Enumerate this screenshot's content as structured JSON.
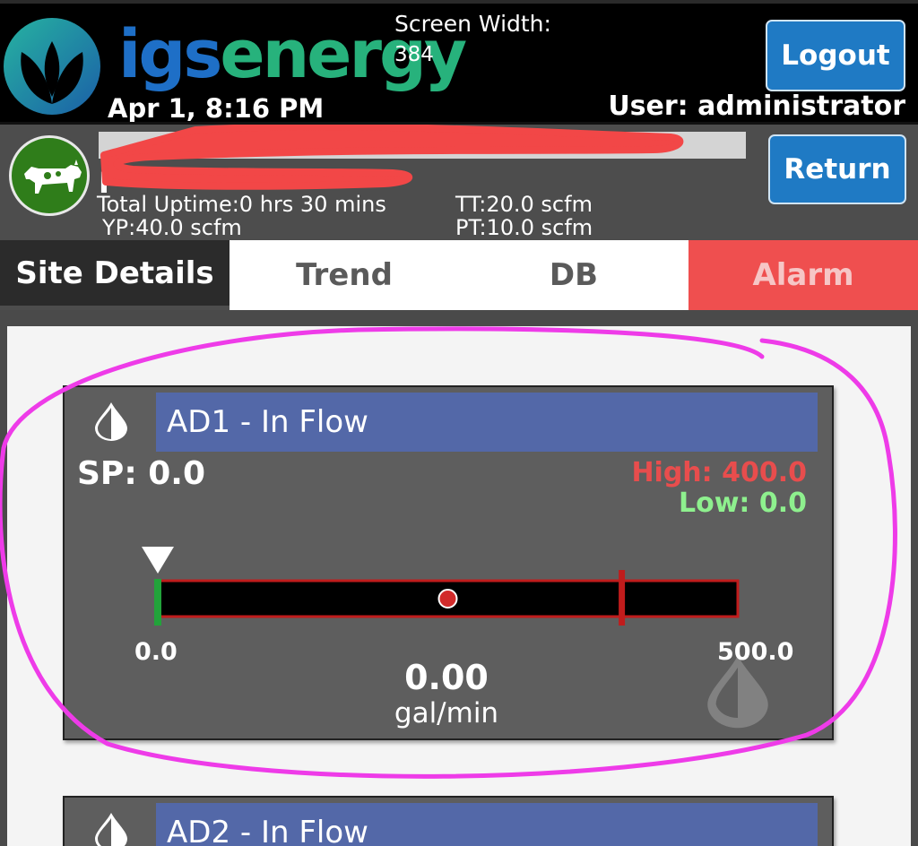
{
  "header": {
    "brand_part1": "igs",
    "brand_part2": "energy",
    "screen_width_label": "Screen Width:",
    "screen_width_value": "384",
    "datetime": "Apr 1, 8:16 PM",
    "user": "User: administrator",
    "logout_label": "Logout",
    "colors": {
      "brand_blue": "#1e6fc7",
      "brand_green": "#27b27c",
      "button": "#1f7ac4"
    }
  },
  "site": {
    "name_visible": "I",
    "uptime": "Total Uptime:0 hrs 30 mins",
    "yp": "YP:40.0 scfm",
    "tt": "TT:20.0 scfm",
    "pt": "PT:10.0 scfm",
    "return_label": "Return",
    "badge_icon": "cow-icon"
  },
  "tabs": [
    {
      "label": "Site Details",
      "active": true
    },
    {
      "label": "Trend",
      "active": false
    },
    {
      "label": "DB",
      "active": false
    },
    {
      "label": "Alarm",
      "active": false,
      "color": "#ef4f4f"
    }
  ],
  "cards": [
    {
      "title": "AD1 - In Flow",
      "icon": "water-drop-icon",
      "sp": "SP: 0.0",
      "high": "High: 400.0",
      "low": "Low: 0.0",
      "gauge": {
        "min": 0.0,
        "max": 500.0,
        "min_label": "0.0",
        "max_label": "500.0",
        "high": 400.0,
        "low": 0.0,
        "setpoint": 0.0,
        "value": 0.0
      },
      "reading": "0.00",
      "unit": "gal/min"
    },
    {
      "title": "AD2 - In Flow",
      "icon": "water-drop-icon"
    }
  ]
}
